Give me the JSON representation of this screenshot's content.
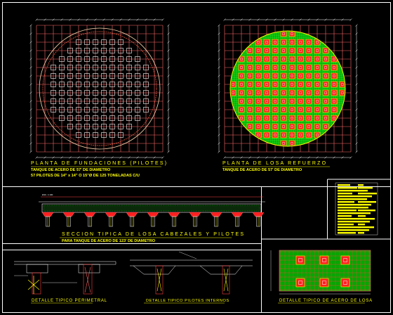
{
  "colors": {
    "grid": "#ff6a6a",
    "frame": "#ffffff",
    "text": "#ffff00",
    "slab_fill": "#00a800",
    "pile": "#ff2020",
    "dim": "#ff3030",
    "rebar": "#00ff00"
  },
  "drawings": {
    "foundation_plan": {
      "title": "PLANTA DE FUNDACIONES (PILOTES)",
      "subtitle": "TANQUE DE ACERO DE 57' DE DIAMETRO",
      "note": "57 PILOTES DE 14\" x 14\" O 15\"Ø DE 125 TONELADAS C/U"
    },
    "slab_plan": {
      "title": "PLANTA DE LOSA REFUERZO",
      "subtitle": "TANQUE DE ACERO DE 57' DE DIAMETRO"
    },
    "section": {
      "title": "SECCION TIPICA DE LOSA CABEZALES Y PILOTES",
      "subtitle": "PARA TANQUE DE ACERO DE 123' DE DIAMETRO"
    },
    "detail_perimeter": {
      "title": "DETALLE TIPICO PERIMETRAL"
    },
    "detail_interior": {
      "title": "DETALLE TIPICO PILOTES INTERNOS"
    },
    "detail_steel": {
      "title": "DETALLE TIPICO DE ACERO DE LOSA"
    }
  }
}
